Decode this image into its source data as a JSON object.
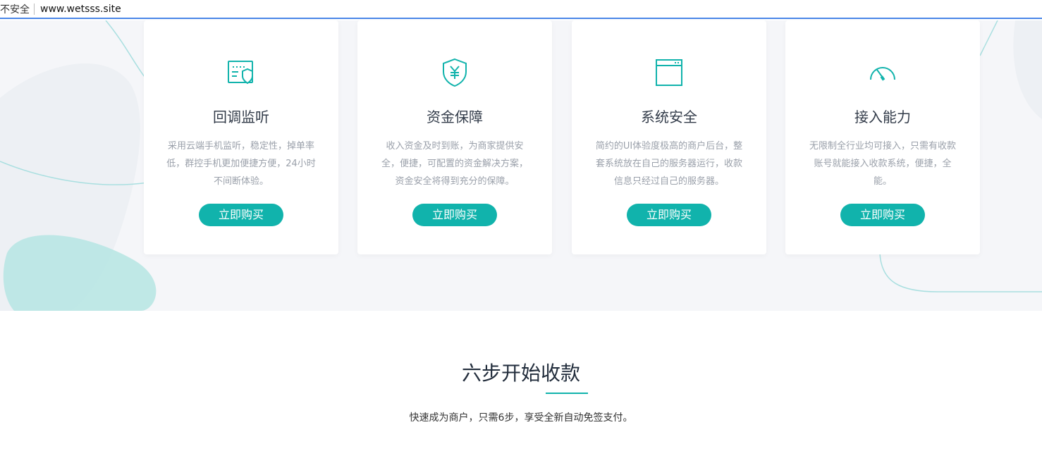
{
  "browser": {
    "security_label": "不安全",
    "url": "www.wetsss.site"
  },
  "colors": {
    "accent": "#11b3ac",
    "card_bg": "#ffffff",
    "hero_bg": "#f5f6f9",
    "title_text": "#333c4a",
    "desc_text": "#9aa0aa"
  },
  "features": [
    {
      "icon": "monitor-shield-icon",
      "title": "回调监听",
      "desc": "采用云端手机监听，稳定性，掉单率低，群控手机更加便捷方便，24小时不间断体验。",
      "button": "立即购买"
    },
    {
      "icon": "yuan-shield-icon",
      "title": "资金保障",
      "desc": "收入资金及时到账，为商家提供安全，便捷，可配置的资金解决方案，资金安全将得到充分的保障。",
      "button": "立即购买"
    },
    {
      "icon": "browser-window-icon",
      "title": "系统安全",
      "desc": "简约的UI体验度极高的商户后台，整套系统放在自己的服务器运行，收款信息只经过自己的服务器。",
      "button": "立即购买"
    },
    {
      "icon": "speedometer-icon",
      "title": "接入能力",
      "desc": "无限制全行业均可接入，只需有收款账号就能接入收款系统，便捷，全能。",
      "button": "立即购买"
    }
  ],
  "steps_section": {
    "title": "六步开始收款",
    "subtitle": "快速成为商户，只需6步，享受全新自动免签支付。"
  }
}
